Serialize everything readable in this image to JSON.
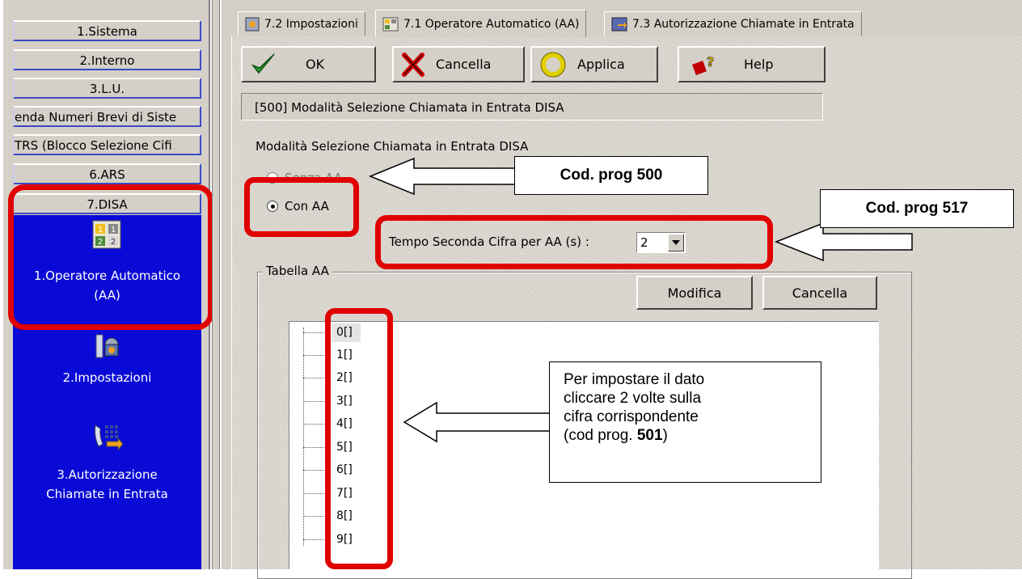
{
  "sidebar": {
    "nav": [
      "1.Sistema",
      "2.Interno",
      "3.L.U.",
      "enda Numeri Brevi di Siste",
      "TRS (Blocco Selezione Cifi",
      "6.ARS",
      "7.DISA"
    ],
    "items": [
      {
        "label_line1": "1.Operatore Automatico",
        "label_line2": "(AA)",
        "icon": "auto-operator-icon"
      },
      {
        "label_line1": "2.Impostazioni",
        "label_line2": "",
        "icon": "settings-icon"
      },
      {
        "label_line1": "3.Autorizzazione",
        "label_line2": "Chiamate in Entrata",
        "icon": "incoming-call-icon"
      }
    ]
  },
  "tabs": [
    {
      "label": "7.2 Impostazioni"
    },
    {
      "label": "7.1 Operatore Automatico (AA)"
    },
    {
      "label": "7.3 Autorizzazione Chiamate in Entrata"
    }
  ],
  "toolbar": {
    "ok": "OK",
    "cancel": "Cancella",
    "apply": "Applica",
    "help": "Help"
  },
  "description": "[500] Modalità Selezione Chiamata in Entrata DISA",
  "mode": {
    "label": "Modalità Selezione Chiamata in Entrata DISA",
    "option1": "Senza AA",
    "option2": "Con AA",
    "selected": "Con AA"
  },
  "second_digit": {
    "label": "Tempo Seconda Cifra per AA (s) :",
    "value": "2"
  },
  "table": {
    "legend": "Tabella AA",
    "modify": "Modifica",
    "cancel": "Cancella",
    "rows": [
      "0[]",
      "1[]",
      "2[]",
      "3[]",
      "4[]",
      "5[]",
      "6[]",
      "7[]",
      "8[]",
      "9[]"
    ]
  },
  "annotations": {
    "prog500": "Cod. prog 500",
    "prog517": "Cod. prog 517",
    "instruction_lines": [
      "Per impostare il dato",
      "cliccare 2 volte sulla",
      "cifra corrispondente"
    ],
    "instruction_prefix": "(cod prog. ",
    "instruction_code": "501",
    "instruction_suffix": ")"
  },
  "colors": {
    "sidebar_blue": "#0a0ad6",
    "highlight_red": "#e00000",
    "panel_gray": "#d4d0c8"
  }
}
